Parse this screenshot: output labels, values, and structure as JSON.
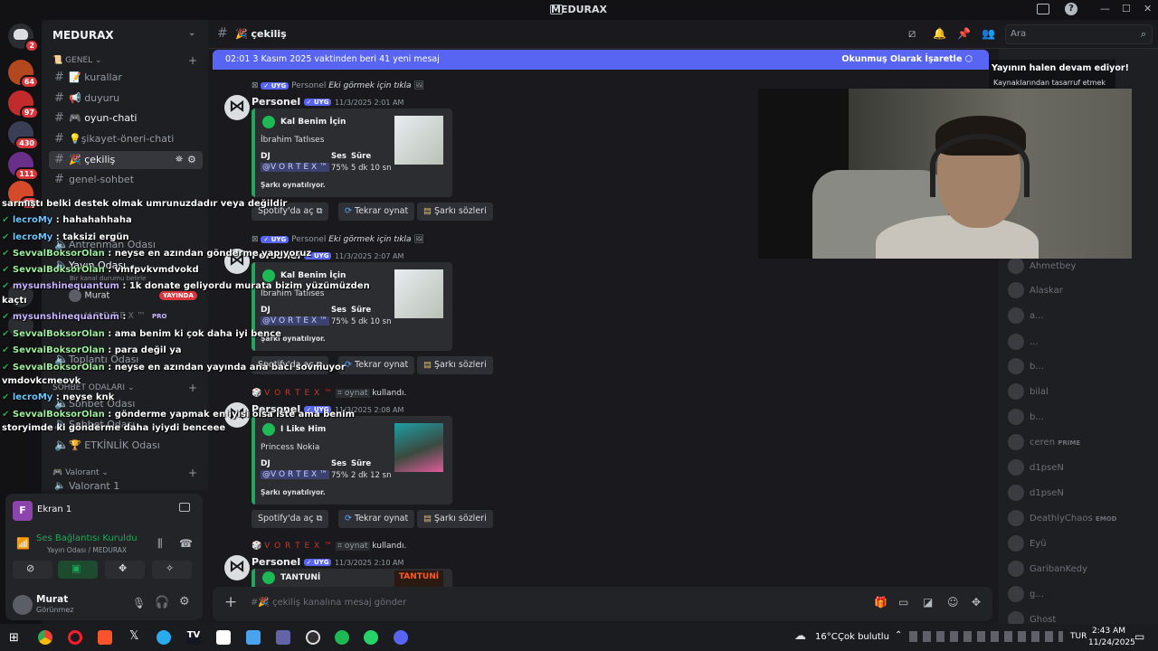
{
  "window": {
    "title": "MEDURAX",
    "controls": [
      "—",
      "☐",
      "✕"
    ]
  },
  "server_rail": {
    "badges": [
      "2",
      "64",
      "97",
      "430",
      "111",
      "99"
    ]
  },
  "sidebar": {
    "server_name": "MEDURAX",
    "categories": {
      "genel": "GENEL",
      "sohbet": "SOHBET ODALARI",
      "valorant": "Valorant"
    },
    "channels": [
      {
        "label": "kurallar",
        "emoji": "📝"
      },
      {
        "label": "duyuru",
        "emoji": "📢"
      },
      {
        "label": "oyun-chati",
        "emoji": "🎮"
      },
      {
        "label": "şikayet-öneri-chati",
        "emoji": "💡"
      },
      {
        "label": "çekiliş",
        "emoji": "🎉"
      },
      {
        "label": "genel-sohbet",
        "emoji": ""
      }
    ],
    "voice": {
      "antrenman": "Antrenman Odası",
      "yayin": "Yayın Odası",
      "yayin_desc": "Bir kanal durumu belirle",
      "user_murat": "Murat",
      "live_badge": "YAYINDA",
      "user_vortex": "V O R T E X ™",
      "pro_badge": "PRO",
      "toplanti": "Toplantı Odası",
      "sohbet_odasi": "Sohbet Odası",
      "sohbet_odasi2": "Sohbet Odası",
      "etkinlik": "🏆 ETKİNLİK Odası",
      "valorant1": "Valorant 1"
    }
  },
  "user_panel": {
    "screen_label": "Ekran 1",
    "screen_initial": "F",
    "voice_status": "Ses Bağlantısı Kuruldu",
    "voice_location": "Yayın Odası / MEDURAX",
    "username": "Murat",
    "status": "Görünmez"
  },
  "header": {
    "channel": "çekiliş",
    "search_placeholder": "Ara"
  },
  "banner": {
    "text": "02:01 3 Kasım 2025 vaktinden beri 41 yeni mesaj",
    "action": "Okunmuş Olarak İşaretle"
  },
  "messages": [
    {
      "reply_line": "Eki görmek için tıkla",
      "reply_user": "Personel",
      "author": "Personel",
      "tag": "UYG",
      "timestamp": "11/3/2025 2:01 AM",
      "embed": {
        "song": "Kal Benim İçin",
        "artist": "İbrahim Tatlıses",
        "dj_label": "DJ",
        "dj": "@V O R T E X ™",
        "volume_label": "Ses",
        "volume": "75%",
        "duration_label": "Süre",
        "duration": "5 dk 10 sn",
        "status": "Şarkı oynatılıyor."
      },
      "buttons": [
        "Spotify'da aç",
        "Tekrar oynat",
        "Şarkı sözleri"
      ]
    },
    {
      "reply_line": "Eki görmek için tıkla",
      "reply_user": "Personel",
      "author": "Personel",
      "tag": "UYG",
      "timestamp": "11/3/2025 2:07 AM",
      "embed": {
        "song": "Kal Benim İçin",
        "artist": "İbrahim Tatlıses",
        "dj_label": "DJ",
        "dj": "@V O R T E X ™",
        "volume_label": "Ses",
        "volume": "75%",
        "duration_label": "Süre",
        "duration": "5 dk 10 sn",
        "status": "Şarkı oynatılıyor."
      },
      "buttons": [
        "Spotify'da aç",
        "Tekrar oynat",
        "Şarkı sözleri"
      ]
    },
    {
      "reply_line": "kullandı.",
      "reply_user": "V O R T E X ™",
      "reply_cmd": "oynat",
      "author": "Personel",
      "tag": "UYG",
      "timestamp": "11/3/2025 2:08 AM",
      "embed": {
        "song": "I Like Him",
        "artist": "Princess Nokia",
        "dj_label": "DJ",
        "dj": "@V O R T E X ™",
        "volume_label": "Ses",
        "volume": "75%",
        "duration_label": "Süre",
        "duration": "2 dk 12 sn",
        "status": "Şarkı oynatılıyor."
      },
      "buttons": [
        "Spotify'da aç",
        "Tekrar oynat",
        "Şarkı sözleri"
      ]
    },
    {
      "reply_line": "kullandı.",
      "reply_user": "V O R T E X ™",
      "reply_cmd": "oynat",
      "author": "Personel",
      "tag": "UYG",
      "timestamp": "11/3/2025 2:10 AM",
      "embed": {
        "song": "TANTUNİ",
        "album_text": "TANTUNİ"
      }
    }
  ],
  "composer": {
    "placeholder": "çekiliş kanalına mesaj gönder"
  },
  "stream_notice": {
    "title": "Yayının halen devam ediyor!",
    "subtitle": "Kaynaklarından tasarruf etmek"
  },
  "members": [
    {
      "name": "Ahmetbey",
      "badge": ""
    },
    {
      "name": "Alaskar",
      "badge": ""
    },
    {
      "name": "a...",
      "badge": ""
    },
    {
      "name": "...",
      "badge": ""
    },
    {
      "name": "b...",
      "badge": ""
    },
    {
      "name": "bilal",
      "badge": ""
    },
    {
      "name": "b...",
      "badge": ""
    },
    {
      "name": "ceren",
      "badge": "PRIME"
    },
    {
      "name": "d1pseN",
      "badge": ""
    },
    {
      "name": "d1pseN",
      "badge": ""
    },
    {
      "name": "DeathlyChaos",
      "badge": "EMOD"
    },
    {
      "name": "Eyü",
      "badge": ""
    },
    {
      "name": "GaribanKedy",
      "badge": ""
    },
    {
      "name": "g...",
      "badge": ""
    },
    {
      "name": "Ghost",
      "badge": ""
    }
  ],
  "chat_overlay": [
    {
      "user": "",
      "text": "sarmıştı belki destek olmak umrunuzdadır veya değildir"
    },
    {
      "user": "lecroMy",
      "text": ": hahahahhaha"
    },
    {
      "user": "lecroMy",
      "text": ": taksizi ergün"
    },
    {
      "user": "SevvalBoksorOlan",
      "text": ": neyse en azından gönderme yapıyoruz"
    },
    {
      "user": "SevvalBoksorOlan",
      "text": ": vmfpvkvmdvokd"
    },
    {
      "user": "mysunshinequantum",
      "text": ": 1k donate geliyordu murata bizim yüzümüzden"
    },
    {
      "user": "",
      "text": "kaçtı"
    },
    {
      "user": "mysunshinequantum",
      "text": ":"
    },
    {
      "user": "SevvalBoksorOlan",
      "text": ": ama benim ki çok daha iyi bence"
    },
    {
      "user": "SevvalBoksorOlan",
      "text": ": para değil ya"
    },
    {
      "user": "SevvalBoksorOlan",
      "text": ": neyse en azından yayında ana bacı sovmuyor"
    },
    {
      "user": "",
      "text": "vmdovkcmeovk"
    },
    {
      "user": "lecroMy",
      "text": ": neyse knk"
    },
    {
      "user": "SevvalBoksorOlan",
      "text": ": gönderme yapmak en iyisi olsa iste ama benim"
    },
    {
      "user": "",
      "text": "storyimde ki gönderme daha iyiydi benceee"
    }
  ],
  "taskbar": {
    "weather_temp": "16°C",
    "weather_desc": "Çok bulutlu",
    "lang": "TUR",
    "time": "2:43 AM",
    "date": "11/24/2025"
  }
}
